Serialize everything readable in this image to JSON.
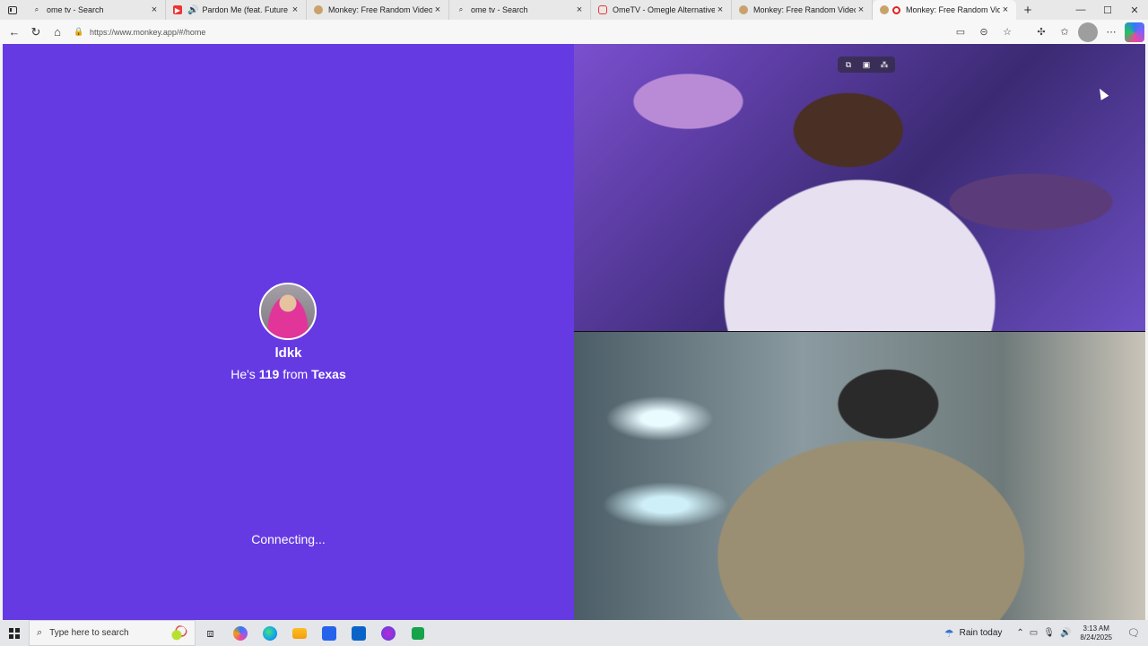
{
  "browser": {
    "tabs": [
      {
        "title": "ome tv - Search",
        "favicon": "search-icon",
        "active": false
      },
      {
        "title": "Pardon Me (feat. Future & M",
        "favicon": "youtube-icon",
        "audio": true,
        "active": false
      },
      {
        "title": "Monkey: Free Random Video Ch",
        "favicon": "monkey-icon",
        "active": false
      },
      {
        "title": "ome tv - Search",
        "favicon": "search-icon",
        "active": false
      },
      {
        "title": "OmeTV - Omegle Alternative for",
        "favicon": "ometv-icon",
        "active": false
      },
      {
        "title": "Monkey: Free Random Video Ch",
        "favicon": "monkey-icon",
        "active": false
      },
      {
        "title": "Monkey: Free Random Vide",
        "favicon": "monkey-icon",
        "recording": true,
        "active": true
      }
    ],
    "close_glyph": "×",
    "new_tab_glyph": "+",
    "window_controls": {
      "minimize": "—",
      "maximize": "☐",
      "close": "✕"
    },
    "url": "https://www.monkey.app/#/home",
    "nav": {
      "back": "←",
      "refresh": "↻",
      "home": "⌂"
    }
  },
  "profile": {
    "name": "ldkk",
    "pronoun_prefix": "He's",
    "age": "119",
    "from_word": "from",
    "location": "Texas"
  },
  "status_text": "Connecting...",
  "colors": {
    "panel_bg": "#653ae3"
  },
  "taskbar": {
    "search_placeholder": "Type here to search",
    "weather": "Rain today",
    "time": "3:13 AM",
    "date": "8/24/2025"
  }
}
